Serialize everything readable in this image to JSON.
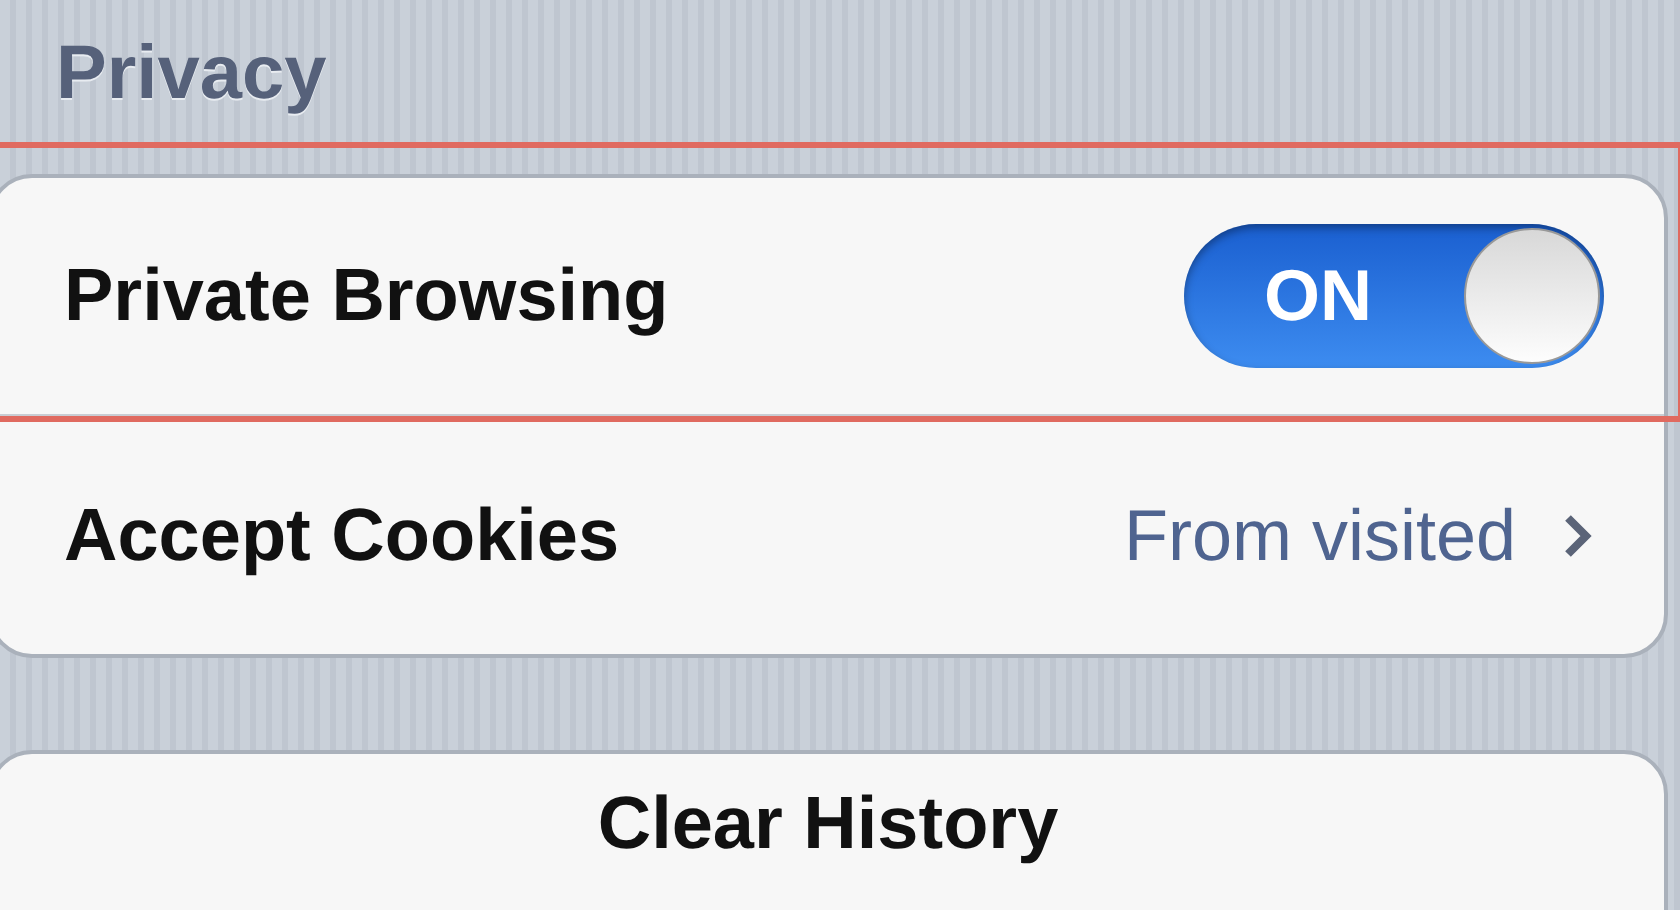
{
  "section_header": "Privacy",
  "rows": [
    {
      "kind": "toggle",
      "label": "Private Browsing",
      "on": true,
      "toggle_text": "ON",
      "highlighted": true
    },
    {
      "kind": "disclosure",
      "label": "Accept Cookies",
      "value": "From visited",
      "highlighted": false
    }
  ],
  "button": {
    "label": "Clear History"
  }
}
